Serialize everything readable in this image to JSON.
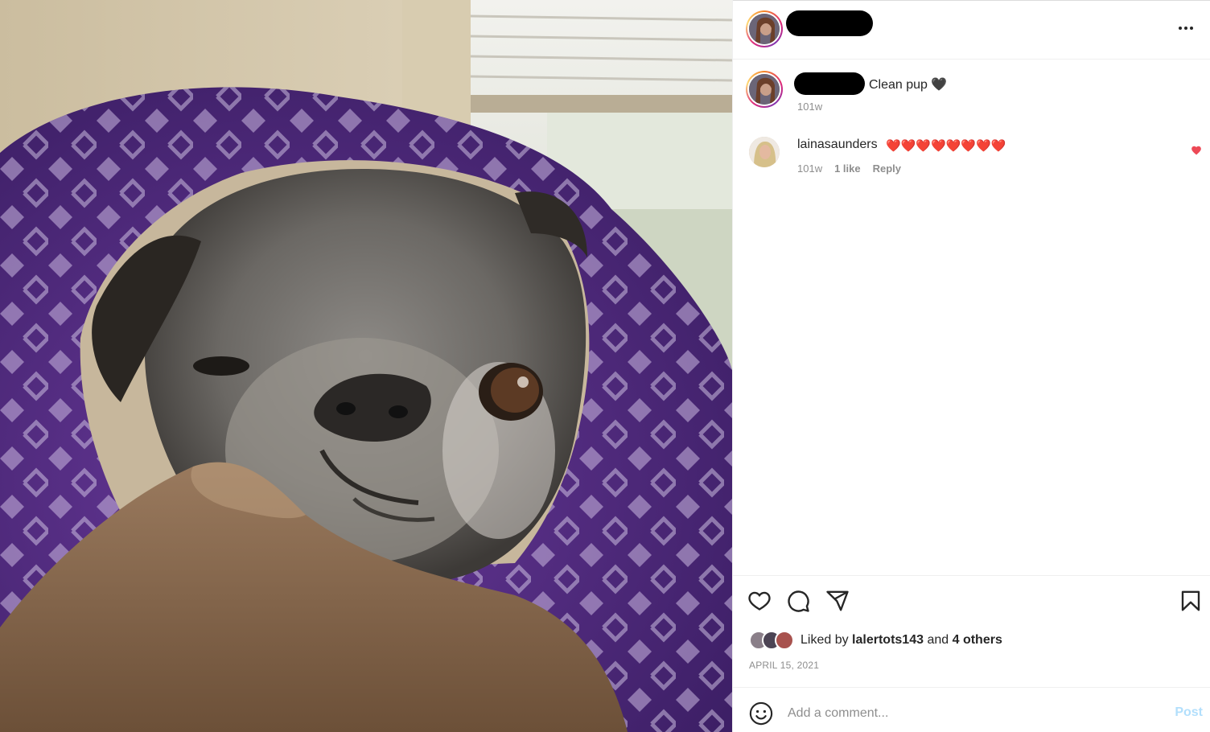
{
  "post": {
    "caption_text": "Clean pup",
    "caption_emoji": "🖤",
    "caption_time": "101w",
    "date": "APRIL 15, 2021"
  },
  "comments": [
    {
      "username": "lainasaunders",
      "text": "❤️❤️❤️❤️❤️❤️❤️❤️",
      "time": "101w",
      "likes": "1 like",
      "reply_label": "Reply",
      "liked": true
    }
  ],
  "likes": {
    "prefix": "Liked by",
    "user": "lalertots143",
    "conjunction": "and",
    "others": "4 others"
  },
  "comment_box": {
    "placeholder": "Add a comment...",
    "post_label": "Post"
  },
  "colors": {
    "heart_red": "#ed4956",
    "post_disabled": "#b2dffc",
    "muted_text": "#8e8e8e"
  },
  "icons": [
    "more-options-icon",
    "like-icon",
    "comment-icon",
    "share-icon",
    "save-icon",
    "emoji-icon"
  ]
}
